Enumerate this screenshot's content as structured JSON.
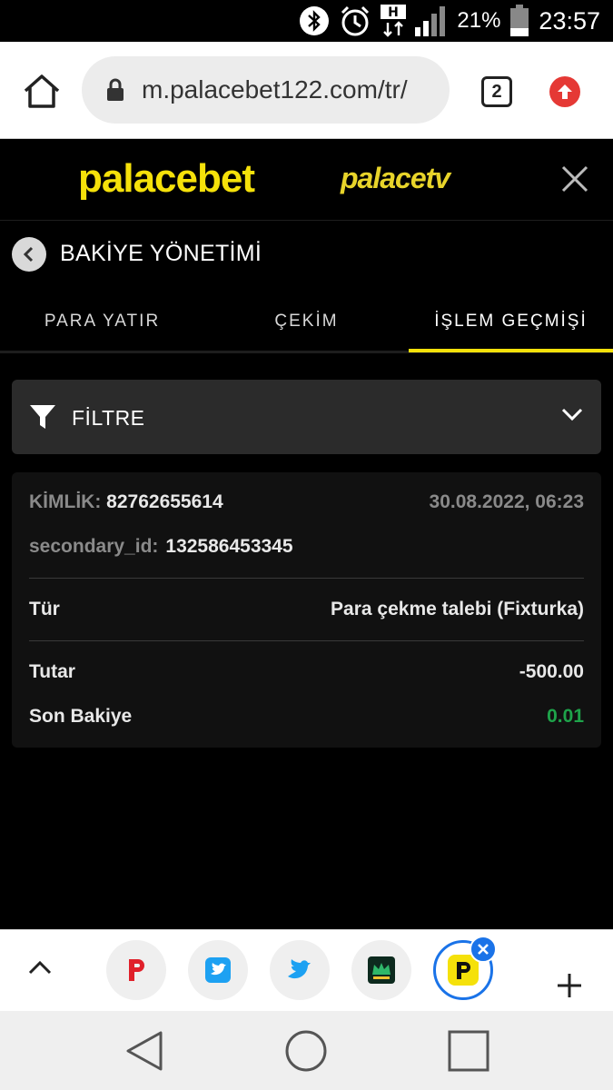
{
  "status_bar": {
    "time": "23:57",
    "battery_percent": "21%",
    "network_label": "H",
    "icons": [
      "bluetooth-icon",
      "alarm-icon",
      "data-arrows-icon",
      "signal-icon",
      "battery-icon"
    ]
  },
  "browser": {
    "url": "m.palacebet122.com/tr/",
    "tab_count": "2",
    "icons": [
      "home-icon",
      "lock-icon",
      "tabs-icon",
      "update-icon"
    ]
  },
  "site_header": {
    "logo_main": "palacebet",
    "logo_secondary": "palacetv",
    "close_icon": "close-icon"
  },
  "page": {
    "title": "BAKİYE YÖNETİMİ"
  },
  "tabs": [
    {
      "label": "PARA YATIR",
      "active": false
    },
    {
      "label": "ÇEKİM",
      "active": false
    },
    {
      "label": "İŞLEM GEÇMİŞİ",
      "active": true
    }
  ],
  "filter": {
    "label": "FİLTRE"
  },
  "transaction": {
    "id_label": "KİMLİK:",
    "id_value": "82762655614",
    "date": "30.08.2022, 06:23",
    "secondary_label": "secondary_id:",
    "secondary_value": "132586453345",
    "type_label": "Tür",
    "type_value": "Para çekme talebi (Fixturka)",
    "amount_label": "Tutar",
    "amount_value": "-500.00",
    "balance_label": "Son Bakiye",
    "balance_value": "0.01"
  },
  "colors": {
    "accent_yellow": "#f5e10a",
    "balance_green": "#1ea34a",
    "tab_active_border": "#1a73e8",
    "update_red": "#e53935"
  },
  "bottom_strip": {
    "tabs": [
      "palacebet-p-icon",
      "twitter-square-icon",
      "twitter-icon",
      "crown-icon",
      "palace-p-icon"
    ],
    "active_index": 4
  }
}
